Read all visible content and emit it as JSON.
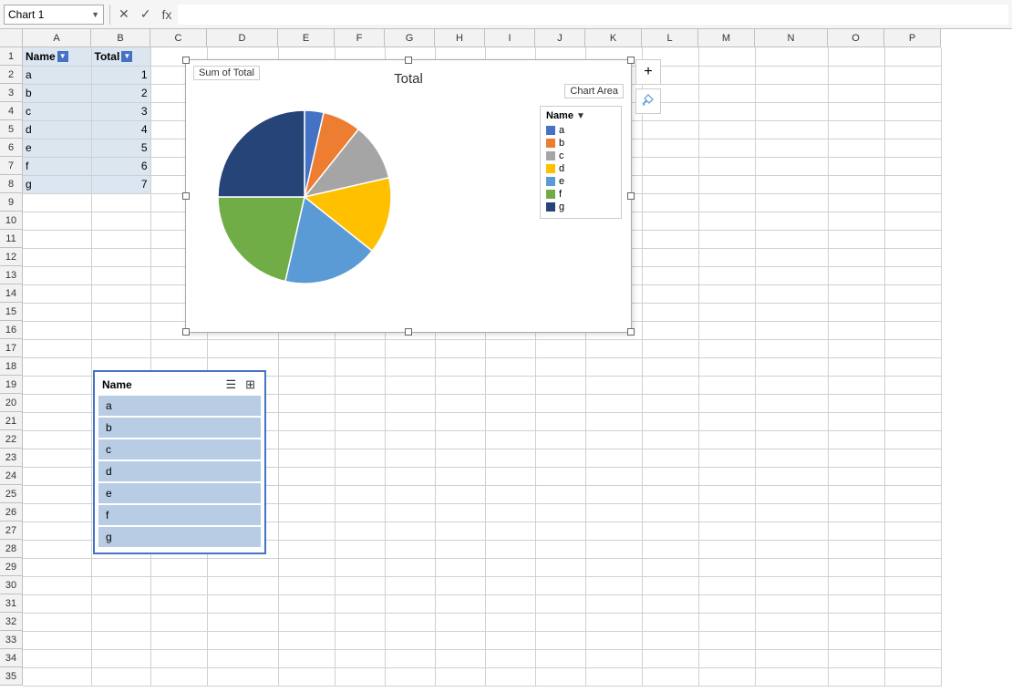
{
  "formulaBar": {
    "nameBox": "Chart 1",
    "nameBoxArrow": "▼",
    "crossIcon": "✕",
    "checkIcon": "✓",
    "fxLabel": "fx"
  },
  "columns": [
    "A",
    "B",
    "C",
    "D",
    "E",
    "F",
    "G",
    "H",
    "I",
    "J",
    "K",
    "L",
    "M",
    "N",
    "O",
    "P"
  ],
  "rows": 35,
  "tableData": {
    "headers": [
      {
        "col": "A",
        "label": "Name"
      },
      {
        "col": "B",
        "label": "Total"
      }
    ],
    "rows": [
      {
        "name": "a",
        "total": 1
      },
      {
        "name": "b",
        "total": 2
      },
      {
        "name": "c",
        "total": 3
      },
      {
        "name": "d",
        "total": 4
      },
      {
        "name": "e",
        "total": 5
      },
      {
        "name": "f",
        "total": 6
      },
      {
        "name": "g",
        "total": 7
      }
    ]
  },
  "chart": {
    "title": "Total",
    "sumLabel": "Sum of Total",
    "chartAreaLabel": "Chart Area",
    "slices": [
      {
        "label": "a",
        "value": 1,
        "color": "#4472c4",
        "startAngle": 0,
        "endAngle": 12.857
      },
      {
        "label": "b",
        "value": 2,
        "color": "#ed7d31",
        "startAngle": 12.857,
        "endAngle": 38.571
      },
      {
        "label": "c",
        "value": 3,
        "color": "#a5a5a5",
        "startAngle": 38.571,
        "endAngle": 77.143
      },
      {
        "label": "d",
        "value": 4,
        "color": "#ffc000",
        "startAngle": 77.143,
        "endAngle": 128.571
      },
      {
        "label": "e",
        "value": 5,
        "color": "#5b9bd5",
        "startAngle": 128.571,
        "endAngle": 192.857
      },
      {
        "label": "f",
        "value": 6,
        "color": "#70ad47",
        "startAngle": 192.857,
        "endAngle": 270
      },
      {
        "label": "g",
        "value": 7,
        "color": "#264478",
        "startAngle": 270,
        "endAngle": 360
      }
    ],
    "legend": {
      "header": "Name",
      "items": [
        {
          "label": "a",
          "color": "#4472c4"
        },
        {
          "label": "b",
          "color": "#ed7d31"
        },
        {
          "label": "c",
          "color": "#a5a5a5"
        },
        {
          "label": "d",
          "color": "#ffc000"
        },
        {
          "label": "e",
          "color": "#5b9bd5"
        },
        {
          "label": "f",
          "color": "#70ad47"
        },
        {
          "label": "g",
          "color": "#264478"
        }
      ]
    }
  },
  "filterPanel": {
    "header": "Name",
    "items": [
      "a",
      "b",
      "c",
      "d",
      "e",
      "f",
      "g"
    ]
  },
  "tools": {
    "addIcon": "+",
    "brushIcon": "✏"
  }
}
